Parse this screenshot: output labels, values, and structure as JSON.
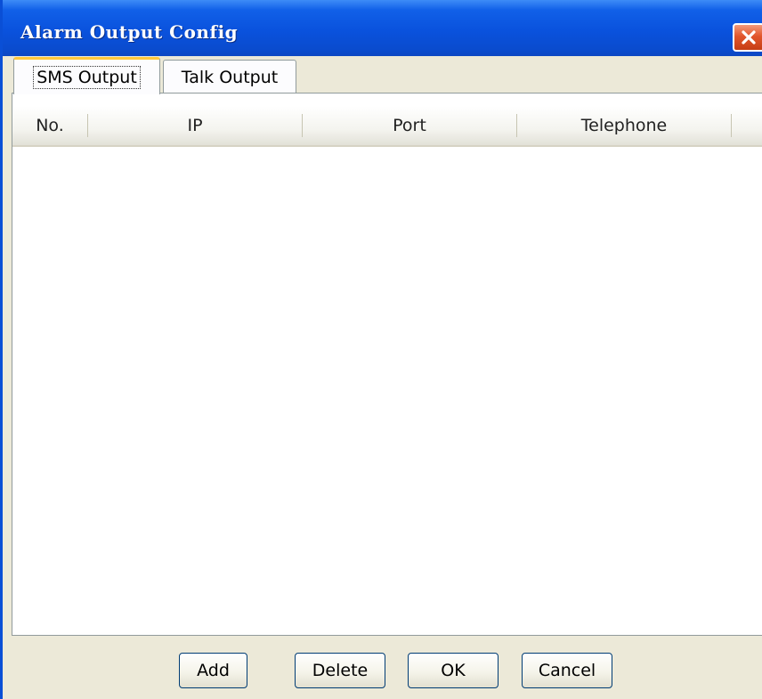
{
  "window": {
    "title": "Alarm Output Config",
    "close_icon": "close-icon"
  },
  "tabs": [
    {
      "label": "SMS Output",
      "active": true
    },
    {
      "label": "Talk Output",
      "active": false
    }
  ],
  "table": {
    "columns": [
      "No.",
      "IP",
      "Port",
      "Telephone"
    ],
    "rows": []
  },
  "buttons": {
    "add": "Add",
    "delete": "Delete",
    "ok": "OK",
    "cancel": "Cancel"
  },
  "colors": {
    "titlebar": "#0a52dd",
    "close_button": "#e2562c",
    "active_tab_accent": "#ffc83c",
    "dialog_background": "#ece9d8"
  }
}
